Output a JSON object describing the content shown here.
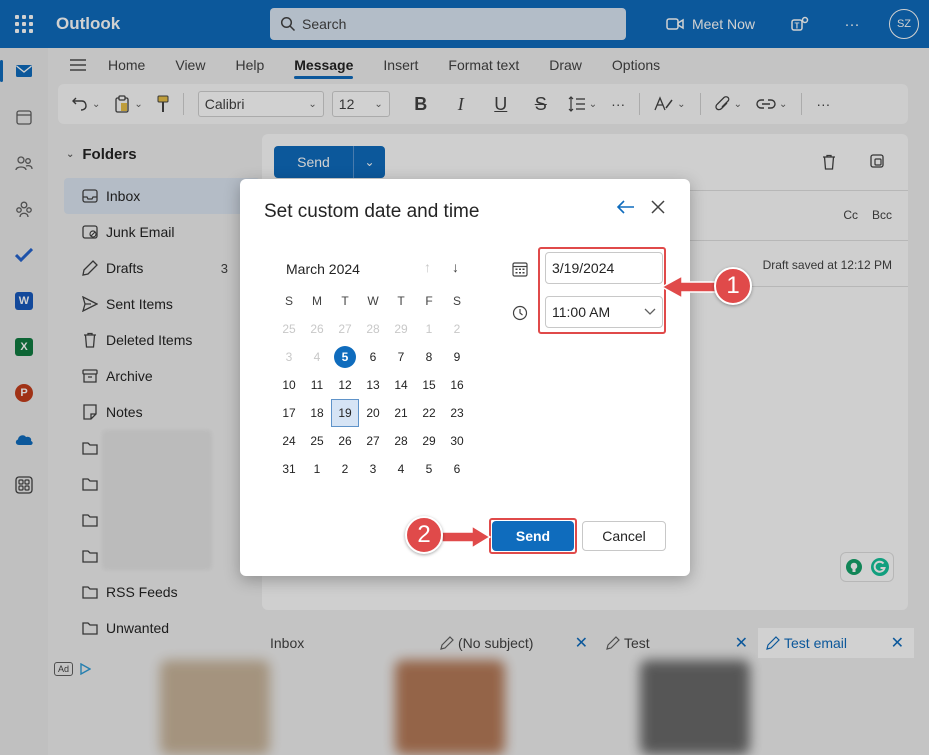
{
  "topbar": {
    "app_name": "Outlook",
    "search_placeholder": "Search",
    "meet_now": "Meet Now",
    "avatar_initials": "SZ",
    "more": "···"
  },
  "ribbon": {
    "tabs": [
      "Home",
      "View",
      "Help",
      "Message",
      "Insert",
      "Format text",
      "Draw",
      "Options"
    ],
    "active_tab": "Message"
  },
  "toolbar": {
    "font_name": "Calibri",
    "font_size": "12",
    "bold": "B",
    "italic": "I",
    "underline": "U",
    "strike": "S",
    "more": "···"
  },
  "folders": {
    "header": "Folders",
    "items": [
      {
        "label": "Inbox",
        "icon": "inbox-icon"
      },
      {
        "label": "Junk Email",
        "icon": "junk-icon"
      },
      {
        "label": "Drafts",
        "icon": "drafts-icon",
        "count": "3"
      },
      {
        "label": "Sent Items",
        "icon": "sent-icon"
      },
      {
        "label": "Deleted Items",
        "icon": "trash-icon"
      },
      {
        "label": "Archive",
        "icon": "archive-icon"
      },
      {
        "label": "Notes",
        "icon": "notes-icon"
      },
      {
        "label": "",
        "icon": "folder-icon"
      },
      {
        "label": "",
        "icon": "folder-icon"
      },
      {
        "label": "",
        "icon": "folder-icon"
      },
      {
        "label": "",
        "icon": "folder-icon"
      },
      {
        "label": "RSS Feeds",
        "icon": "folder-icon"
      },
      {
        "label": "Unwanted",
        "icon": "folder-icon"
      }
    ],
    "ad_label": "Ad"
  },
  "compose": {
    "send_label": "Send",
    "cc_label": "Cc",
    "bcc_label": "Bcc",
    "draft_status": "Draft saved at 12:12 PM"
  },
  "bottom_tabs": [
    {
      "label": "Inbox"
    },
    {
      "label": "(No subject)"
    },
    {
      "label": "Test"
    },
    {
      "label": "Test email"
    }
  ],
  "dialog": {
    "title": "Set custom date and time",
    "month_label": "March 2024",
    "weekdays": [
      "S",
      "M",
      "T",
      "W",
      "T",
      "F",
      "S"
    ],
    "weeks": [
      [
        {
          "d": "25",
          "dim": true
        },
        {
          "d": "26",
          "dim": true
        },
        {
          "d": "27",
          "dim": true
        },
        {
          "d": "28",
          "dim": true
        },
        {
          "d": "29",
          "dim": true
        },
        {
          "d": "1",
          "dim": true
        },
        {
          "d": "2",
          "dim": true
        }
      ],
      [
        {
          "d": "3",
          "dim": true
        },
        {
          "d": "4",
          "dim": true
        },
        {
          "d": "5",
          "today": true
        },
        {
          "d": "6"
        },
        {
          "d": "7"
        },
        {
          "d": "8"
        },
        {
          "d": "9"
        }
      ],
      [
        {
          "d": "10"
        },
        {
          "d": "11"
        },
        {
          "d": "12"
        },
        {
          "d": "13"
        },
        {
          "d": "14"
        },
        {
          "d": "15"
        },
        {
          "d": "16"
        }
      ],
      [
        {
          "d": "17"
        },
        {
          "d": "18"
        },
        {
          "d": "19",
          "selected": true
        },
        {
          "d": "20"
        },
        {
          "d": "21"
        },
        {
          "d": "22"
        },
        {
          "d": "23"
        }
      ],
      [
        {
          "d": "24"
        },
        {
          "d": "25"
        },
        {
          "d": "26"
        },
        {
          "d": "27"
        },
        {
          "d": "28"
        },
        {
          "d": "29"
        },
        {
          "d": "30"
        }
      ],
      [
        {
          "d": "31"
        },
        {
          "d": "1"
        },
        {
          "d": "2"
        },
        {
          "d": "3"
        },
        {
          "d": "4"
        },
        {
          "d": "5"
        },
        {
          "d": "6"
        }
      ]
    ],
    "date_value": "3/19/2024",
    "time_value": "11:00 AM",
    "send_label": "Send",
    "cancel_label": "Cancel"
  },
  "annotations": {
    "step1": "1",
    "step2": "2",
    "color": "#e04a4a"
  },
  "colors": {
    "brand": "#0f6cbd"
  }
}
